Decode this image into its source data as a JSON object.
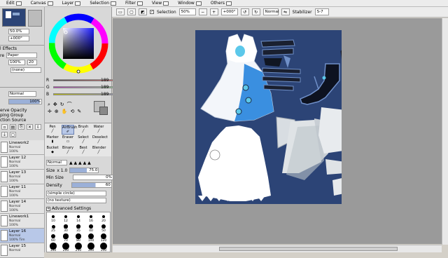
{
  "menubar": {
    "items": [
      {
        "label": "Edit",
        "icon": "edit-icon"
      },
      {
        "label": "Canvas",
        "icon": "canvas-icon"
      },
      {
        "label": "Layer",
        "icon": "layer-icon"
      },
      {
        "label": "Selection",
        "icon": "selection-icon"
      },
      {
        "label": "Filter",
        "icon": "filter-icon"
      },
      {
        "label": "View",
        "icon": "view-icon"
      },
      {
        "label": "Window",
        "icon": "window-icon"
      },
      {
        "label": "Others",
        "icon": "others-icon"
      }
    ]
  },
  "toolbar": {
    "selection_label": "Selection",
    "zoom": "50%",
    "rotation": "+000°",
    "blend": "Normal",
    "stabilizer_label": "Stabilizer",
    "stabilizer_value": "S-7"
  },
  "navigator": {
    "zoom": "50.0%",
    "rotation": "+000°"
  },
  "effects": {
    "title": "l Effects",
    "texture_label": "re",
    "texture_value": "Paper",
    "texture_amount": "100%",
    "texture_num": "20",
    "effect_label": "",
    "effect_value": "(none)"
  },
  "layer_props": {
    "mode": "Normal",
    "opacity": "100%",
    "options": [
      "erve Opacity",
      "ping Group",
      "ction Source"
    ]
  },
  "layers": [
    {
      "name": "Linework2",
      "mode": "Normal",
      "opacity": "100%",
      "selected": false
    },
    {
      "name": "Layer 12",
      "mode": "Normal",
      "opacity": "100%",
      "selected": false
    },
    {
      "name": "Layer 13",
      "mode": "Normal",
      "opacity": "100%",
      "selected": false
    },
    {
      "name": "Layer 11",
      "mode": "Normal",
      "opacity": "100%",
      "selected": false
    },
    {
      "name": "Layer 14",
      "mode": "Normal",
      "opacity": "100%",
      "selected": false
    },
    {
      "name": "Linework1",
      "mode": "Normal",
      "opacity": "100%",
      "selected": false
    },
    {
      "name": "Layer 16",
      "mode": "Normal",
      "opacity": "100% Tim",
      "selected": true
    },
    {
      "name": "Layer 15",
      "mode": "Normal",
      "opacity": "100%",
      "selected": false
    }
  ],
  "color": {
    "r_label": "R",
    "g_label": "G",
    "b_label": "B",
    "r": "189",
    "g": "189",
    "b": "189",
    "current": "#bdbdbd"
  },
  "tools": {
    "brushes": [
      {
        "label": "Pen"
      },
      {
        "label": "AirBrush"
      },
      {
        "label": "Brush"
      },
      {
        "label": "Water"
      },
      {
        "label": "Marker"
      },
      {
        "label": "Eraser"
      },
      {
        "label": "Select"
      },
      {
        "label": "Deselect"
      },
      {
        "label": "Bucket"
      },
      {
        "label": "Binary"
      },
      {
        "label": "Best"
      },
      {
        "label": "Blender"
      }
    ]
  },
  "brush_settings": {
    "mode": "Normal",
    "size_label": "Size",
    "size_mult": "x 1.0",
    "size_value": "75.0",
    "min_size_label": "Min Size",
    "min_size_value": "0%",
    "density_label": "Density",
    "density_value": "60",
    "shape": "(simple circle)",
    "texture": "(no texture)",
    "advanced_label": "Advanced Settings",
    "sizes": [
      "10",
      "12",
      "14",
      "16",
      "20",
      "25",
      "30",
      "35",
      "40",
      "50",
      "60",
      "70",
      "80",
      "100",
      "120",
      "160",
      "200",
      "250",
      "300",
      "350"
    ]
  }
}
